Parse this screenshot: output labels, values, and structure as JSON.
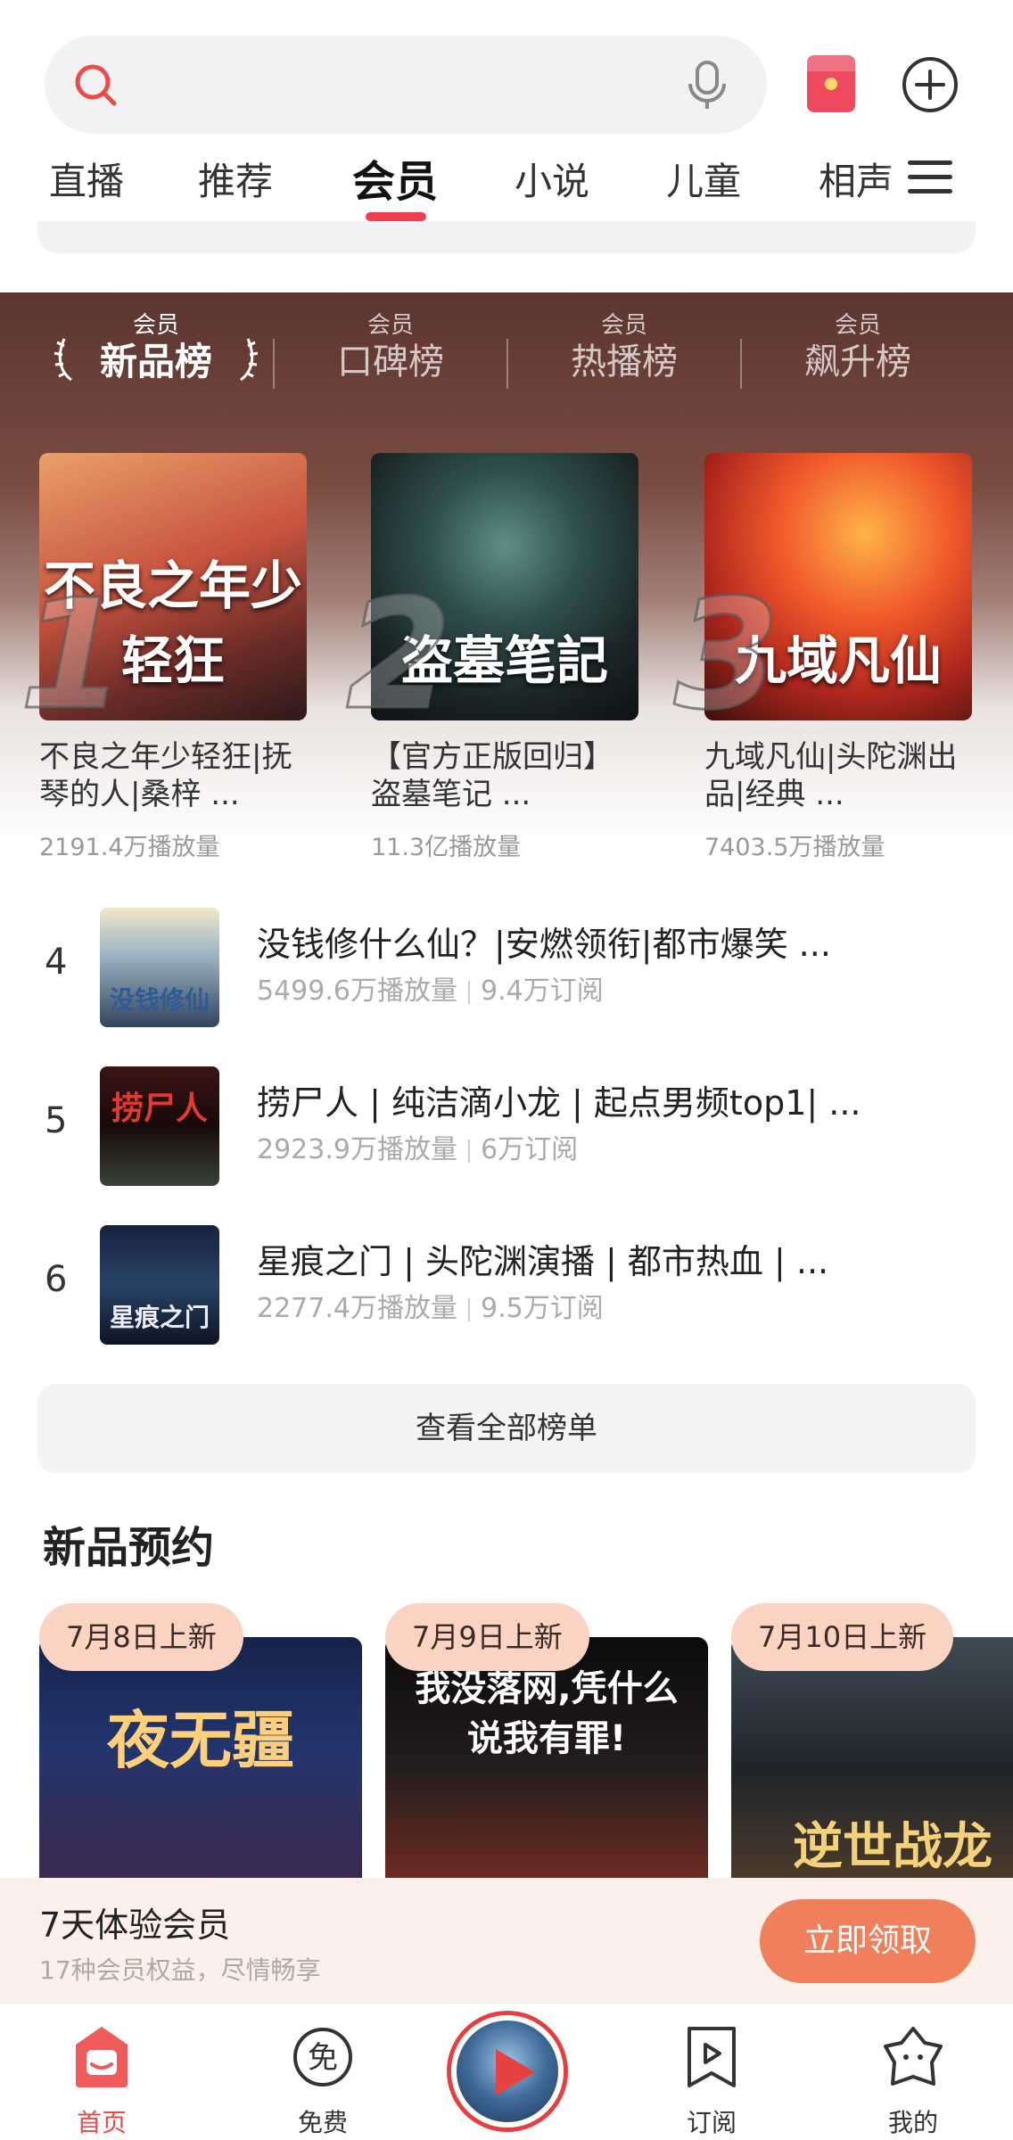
{
  "tabs": [
    "直播",
    "推荐",
    "会员",
    "小说",
    "儿童",
    "相声"
  ],
  "active_tab": "会员",
  "rank": {
    "tabs": [
      {
        "small": "会员",
        "big": "新品榜"
      },
      {
        "small": "会员",
        "big": "口碑榜"
      },
      {
        "small": "会员",
        "big": "热播榜"
      },
      {
        "small": "会员",
        "big": "飙升榜"
      }
    ],
    "top3": [
      {
        "rank": "1",
        "cover_text": "不良之年少轻狂",
        "title": "不良之年少轻狂|抚琴的人|桑梓 ...",
        "plays": "2191.4万播放量"
      },
      {
        "rank": "2",
        "cover_text": "盗墓笔記",
        "title": "【官方正版回归】盗墓笔记 ...",
        "plays": "11.3亿播放量"
      },
      {
        "rank": "3",
        "cover_text": "九域凡仙",
        "title": "九域凡仙|头陀渊出品|经典 ...",
        "plays": "7403.5万播放量"
      }
    ],
    "list": [
      {
        "rank": "4",
        "thumb_text": "没钱修仙",
        "title": "没钱修什么仙？|安燃领衔|都市爆笑 ...",
        "plays": "5499.6万播放量",
        "subs": "9.4万订阅"
      },
      {
        "rank": "5",
        "thumb_text": "捞尸人",
        "title": "捞尸人 | 纯洁滴小龙 | 起点男频top1| ...",
        "plays": "2923.9万播放量",
        "subs": "6万订阅"
      },
      {
        "rank": "6",
        "thumb_text": "星痕之门",
        "title": "星痕之门 | 头陀渊演播 | 都市热血 | ...",
        "plays": "2277.4万播放量",
        "subs": "9.5万订阅"
      }
    ],
    "view_all": "查看全部榜单"
  },
  "preorder": {
    "title": "新品预约",
    "items": [
      {
        "badge": "7月8日上新",
        "art": "夜无疆"
      },
      {
        "badge": "7月9日上新",
        "art": "我没落网,凭什么说我有罪!"
      },
      {
        "badge": "7月10日上新",
        "art": "逆世战龙"
      }
    ]
  },
  "promo": {
    "title": "7天体验会员",
    "subtitle": "17种会员权益，尽情畅享",
    "button": "立即领取"
  },
  "nav": [
    {
      "label": "首页",
      "icon": "home-icon"
    },
    {
      "label": "免费",
      "icon": "free-icon"
    },
    {
      "label": "订阅",
      "icon": "subscribe-icon"
    },
    {
      "label": "我的",
      "icon": "profile-icon"
    }
  ],
  "colors": {
    "accent": "#ef3f4f",
    "promo_button": "#f0805b",
    "badge": "#fbd3c3"
  }
}
